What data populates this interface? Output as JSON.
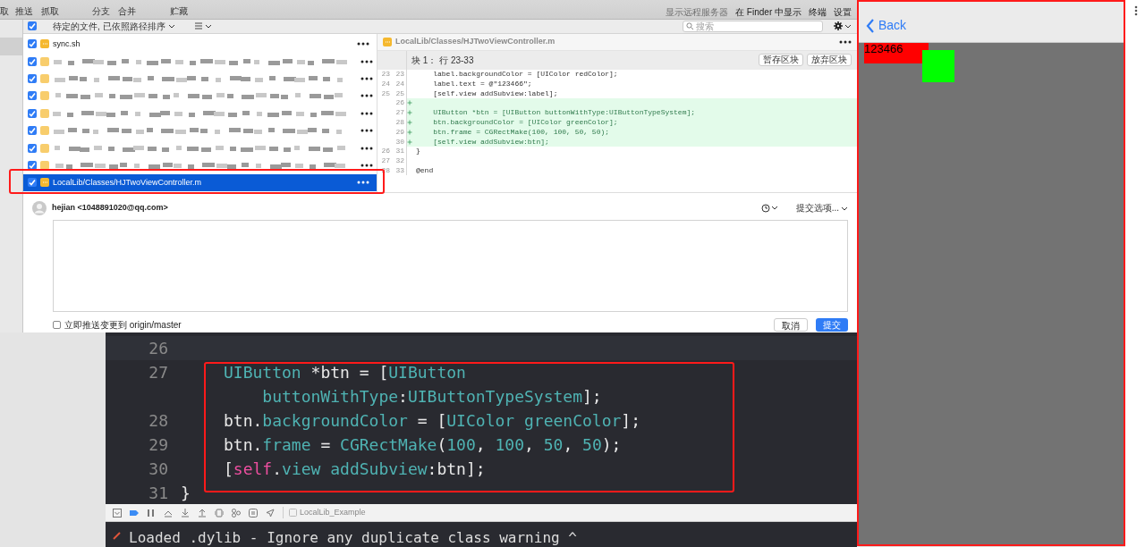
{
  "toolbar": {
    "left_items": [
      {
        "label": "取"
      },
      {
        "label": "推送"
      },
      {
        "label": "抓取"
      },
      {
        "label": "分支"
      },
      {
        "label": "合并"
      },
      {
        "label": "贮藏"
      }
    ],
    "right_items": [
      {
        "label": "显示远程服务器",
        "disabled": true
      },
      {
        "label": "在 Finder 中显示",
        "disabled": false
      },
      {
        "label": "终端",
        "disabled": false
      },
      {
        "label": "设置",
        "disabled": false
      }
    ]
  },
  "file_list": {
    "all_checked": true,
    "sort_label": "待定的文件, 已依照路径排序",
    "files": [
      {
        "kind": "file",
        "path": "sync.sh",
        "checked": true,
        "selected": false
      },
      {
        "kind": "redacted",
        "checked": true,
        "selected": false
      },
      {
        "kind": "redacted",
        "checked": true,
        "selected": false
      },
      {
        "kind": "redacted",
        "checked": true,
        "selected": false
      },
      {
        "kind": "redacted",
        "checked": true,
        "selected": false
      },
      {
        "kind": "redacted",
        "checked": true,
        "selected": false
      },
      {
        "kind": "redacted",
        "checked": true,
        "selected": false
      },
      {
        "kind": "redacted",
        "checked": true,
        "selected": false
      },
      {
        "kind": "file",
        "path": "LocalLib/Classes/HJTwoViewController.m",
        "checked": true,
        "selected": true
      }
    ]
  },
  "search": {
    "placeholder": "搜索"
  },
  "diff": {
    "file": "LocalLib/Classes/HJTwoViewController.m",
    "hunk_title": "块 1： 行 23-33",
    "buttons": [
      "暂存区块",
      "放弃区块"
    ],
    "lines": [
      {
        "kind": "context",
        "old": "23",
        "new": "23",
        "text": "    label.backgroundColor = [UIColor redColor];"
      },
      {
        "kind": "context",
        "old": "24",
        "new": "24",
        "text": "    label.text = @\"123466\";"
      },
      {
        "kind": "context",
        "old": "25",
        "new": "25",
        "text": "    [self.view addSubview:label];"
      },
      {
        "kind": "added",
        "new": "26"
      },
      {
        "kind": "added",
        "new": "27",
        "text": "    UIButton *btn = [UIButton buttonWithType:UIButtonTypeSystem];"
      },
      {
        "kind": "added",
        "new": "28",
        "text": "    btn.backgroundColor = [UIColor greenColor];"
      },
      {
        "kind": "added",
        "new": "29",
        "text": "    btn.frame = CGRectMake(100, 100, 50, 50);"
      },
      {
        "kind": "added",
        "new": "30",
        "text": "    [self.view addSubview:btn];"
      },
      {
        "kind": "context",
        "old": "26",
        "new": "31",
        "text": "}"
      },
      {
        "kind": "context",
        "old": "27",
        "new": "32"
      },
      {
        "kind": "context",
        "old": "28",
        "new": "33",
        "text": "@end"
      }
    ]
  },
  "commit": {
    "author": "hejian <1048891020@qq.com>",
    "options": "提交选项...",
    "push_label": "立即推送变更到 origin/master",
    "push_checked": false,
    "cancel": "取消",
    "submit": "提交"
  },
  "editor": {
    "lines": [
      {
        "number": "26"
      },
      {
        "number": "27",
        "segments": [
          {
            "kind": "type",
            "text": "UIButton"
          },
          {
            "kind": "plain",
            "text": " *btn = ["
          },
          {
            "kind": "type",
            "text": "UIButton"
          }
        ]
      },
      {
        "segments": [
          {
            "kind": "type",
            "text": "    buttonWithType"
          },
          {
            "kind": "plain",
            "text": ":"
          },
          {
            "kind": "type",
            "text": "UIButtonTypeSystem"
          },
          {
            "kind": "plain",
            "text": "];"
          }
        ]
      },
      {
        "number": "28",
        "segments": [
          {
            "kind": "plain",
            "text": "btn."
          },
          {
            "kind": "type",
            "text": "backgroundColor"
          },
          {
            "kind": "plain",
            "text": " = ["
          },
          {
            "kind": "type",
            "text": "UIColor greenColor"
          },
          {
            "kind": "plain",
            "text": "];"
          }
        ]
      },
      {
        "number": "29",
        "segments": [
          {
            "kind": "plain",
            "text": "btn."
          },
          {
            "kind": "type",
            "text": "frame"
          },
          {
            "kind": "plain",
            "text": " = "
          },
          {
            "kind": "type",
            "text": "CGRectMake"
          },
          {
            "kind": "plain",
            "text": "("
          },
          {
            "kind": "number",
            "text": "100"
          },
          {
            "kind": "plain",
            "text": ", "
          },
          {
            "kind": "number",
            "text": "100"
          },
          {
            "kind": "plain",
            "text": ", "
          },
          {
            "kind": "number",
            "text": "50"
          },
          {
            "kind": "plain",
            "text": ", "
          },
          {
            "kind": "number",
            "text": "50"
          },
          {
            "kind": "plain",
            "text": ");"
          }
        ]
      },
      {
        "number": "30",
        "segments": [
          {
            "kind": "plain",
            "text": "["
          },
          {
            "kind": "keyword",
            "text": "self"
          },
          {
            "kind": "plain",
            "text": "."
          },
          {
            "kind": "type",
            "text": "view addSubview"
          },
          {
            "kind": "plain",
            "text": ":btn];"
          }
        ]
      },
      {
        "number": "31",
        "segments": [
          {
            "kind": "brace",
            "text": "}"
          }
        ]
      }
    ],
    "scheme": "LocalLib_Example",
    "console": "Loaded .dylib - Ignore any duplicate class warning ^"
  },
  "simulator": {
    "back": "Back",
    "label_text": "123466"
  }
}
